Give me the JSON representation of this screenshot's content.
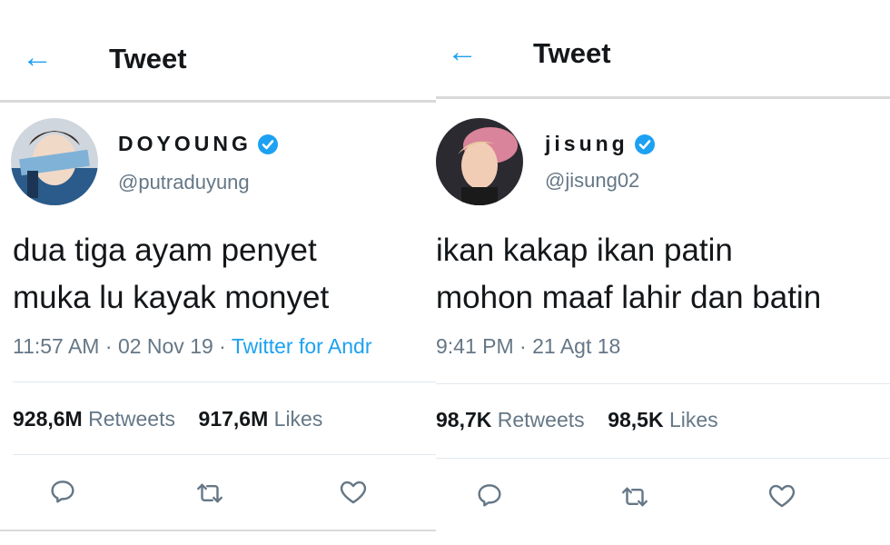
{
  "tweets": [
    {
      "header_title": "Tweet",
      "name": "DOYOUNG",
      "handle": "@putraduyung",
      "text_line1": "dua tiga ayam penyet",
      "text_line2": "muka lu kayak monyet",
      "time": "11:57 AM",
      "date": "02 Nov 19",
      "source": "Twitter for Andr",
      "retweets_count": "928,6M",
      "retweets_label": "Retweets",
      "likes_count": "917,6M",
      "likes_label": "Likes"
    },
    {
      "header_title": "Tweet",
      "name": "jisung",
      "handle": "@jisung02",
      "text_line1": "ikan kakap ikan patin",
      "text_line2": "mohon maaf lahir dan batin",
      "time": "9:41 PM",
      "date": "21 Agt 18",
      "retweets_count": "98,7K",
      "retweets_label": "Retweets",
      "likes_count": "98,5K",
      "likes_label": "Likes"
    }
  ],
  "icons": {
    "back": "back-arrow-icon",
    "verified": "verified-badge-icon",
    "reply": "reply-icon",
    "retweet": "retweet-icon",
    "like": "heart-icon"
  },
  "colors": {
    "accent": "#1da1f2",
    "muted": "#657786",
    "text": "#14171a"
  }
}
